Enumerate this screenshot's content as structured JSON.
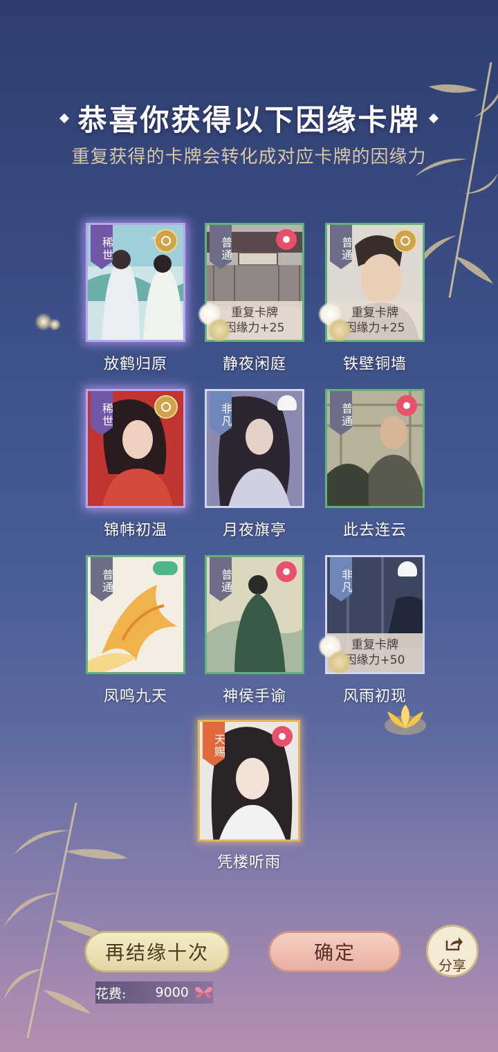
{
  "header": {
    "title": "恭喜你获得以下因缘卡牌",
    "subtitle": "重复获得的卡牌会转化成对应卡牌的因缘力"
  },
  "cards": [
    {
      "name": "放鹤归原",
      "rarity": "稀世",
      "rarity_key": "rare",
      "emblem": "gold-coin-icon",
      "duplicate": null
    },
    {
      "name": "静夜闲庭",
      "rarity": "普通",
      "rarity_key": "common",
      "emblem": "red-flower-icon",
      "duplicate": {
        "line1": "重复卡牌",
        "line2": "因缘力+25"
      }
    },
    {
      "name": "铁壁铜墙",
      "rarity": "普通",
      "rarity_key": "common",
      "emblem": "gold-coin-icon",
      "duplicate": {
        "line1": "重复卡牌",
        "line2": "因缘力+25"
      }
    },
    {
      "name": "锦帏初温",
      "rarity": "稀世",
      "rarity_key": "rare",
      "emblem": "gold-coin-icon",
      "duplicate": null
    },
    {
      "name": "月夜旗亭",
      "rarity": "非凡",
      "rarity_key": "fanpin",
      "emblem": "fan-icon",
      "duplicate": null
    },
    {
      "name": "此去连云",
      "rarity": "普通",
      "rarity_key": "common",
      "emblem": "red-flower-icon",
      "duplicate": null
    },
    {
      "name": "凤鸣九天",
      "rarity": "普通",
      "rarity_key": "common",
      "emblem": "green-leaf-icon",
      "duplicate": null
    },
    {
      "name": "神侯手谕",
      "rarity": "普通",
      "rarity_key": "common",
      "emblem": "red-flower-icon",
      "duplicate": null
    },
    {
      "name": "风雨初现",
      "rarity": "非凡",
      "rarity_key": "fanpin",
      "emblem": "fan-icon",
      "duplicate": {
        "line1": "重复卡牌",
        "line2": "因缘力+50"
      }
    },
    {
      "name": "凭楼听雨",
      "rarity": "天赐",
      "rarity_key": "tianci",
      "emblem": "red-flower-icon",
      "duplicate": null
    }
  ],
  "footer": {
    "again_button": "再结缘十次",
    "confirm_button": "确定",
    "share_button": "分享",
    "cost_label": "花费:",
    "cost_value": "9000",
    "cost_icon": "butterfly-icon"
  },
  "colors": {
    "common_border": "#5fb37a",
    "rare_glow": "#b9a4f0",
    "tianci_tag": "#e0683a"
  }
}
